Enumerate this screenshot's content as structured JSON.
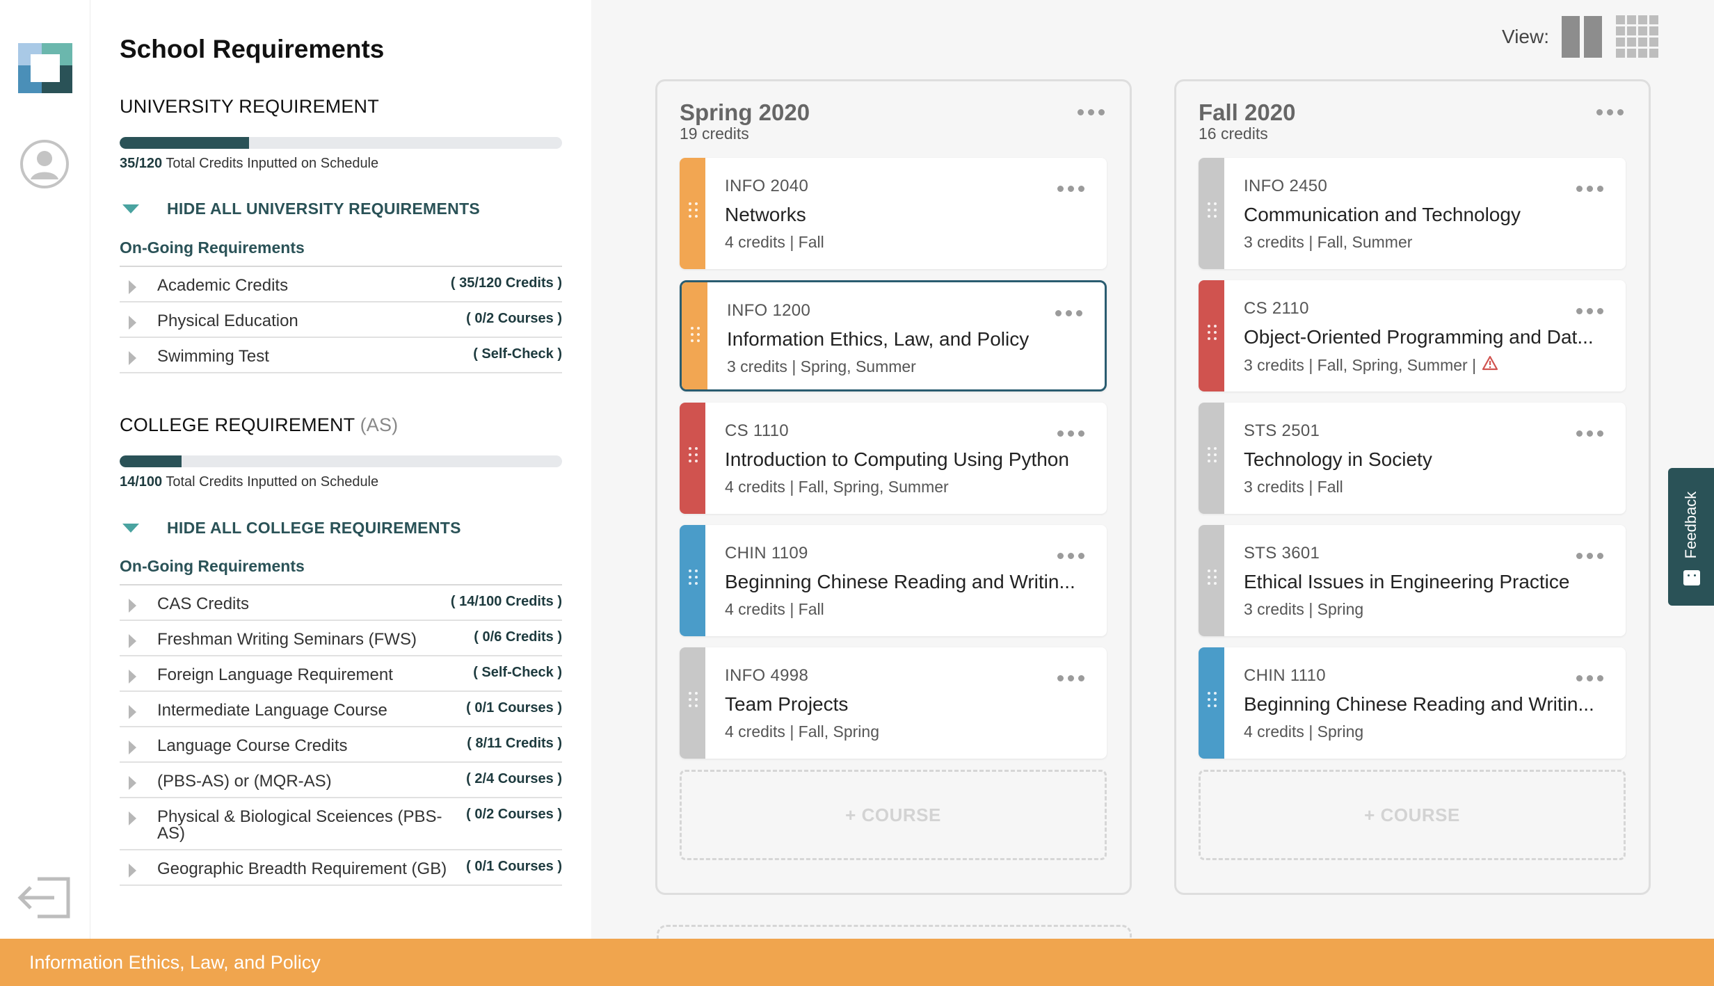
{
  "requirements": {
    "title": "School Requirements",
    "university": {
      "title": "UNIVERSITY REQUIREMENT",
      "progress": 0.2917,
      "progress_value": "35/120",
      "progress_text": "Total Credits Inputted on Schedule",
      "toggle": "HIDE ALL UNIVERSITY REQUIREMENTS",
      "ongoing": "On-Going Requirements",
      "rows": [
        {
          "name": "Academic Credits",
          "value": "( 35/120 Credits )"
        },
        {
          "name": "Physical Education",
          "value": "( 0/2 Courses )"
        },
        {
          "name": "Swimming Test",
          "value": "( Self-Check )"
        }
      ]
    },
    "college": {
      "title": "COLLEGE REQUIREMENT",
      "subtitle": "(AS)",
      "progress": 0.14,
      "progress_value": "14/100",
      "progress_text": "Total Credits Inputted on Schedule",
      "toggle": "HIDE ALL COLLEGE REQUIREMENTS",
      "ongoing": "On-Going Requirements",
      "rows": [
        {
          "name": "CAS Credits",
          "value": "( 14/100 Credits )"
        },
        {
          "name": "Freshman Writing Seminars (FWS)",
          "value": "( 0/6 Credits )"
        },
        {
          "name": "Foreign Language Requirement",
          "value": "( Self-Check )"
        },
        {
          "name": "Intermediate Language Course",
          "value": "( 0/1 Courses )"
        },
        {
          "name": "Language Course Credits",
          "value": "( 8/11 Credits )"
        },
        {
          "name": "(PBS-AS) or (MQR-AS)",
          "value": "( 2/4 Courses )"
        },
        {
          "name": "Physical & Biological Sceiences (PBS-AS)",
          "value": "( 0/2 Courses )"
        },
        {
          "name": "Geographic Breadth Requirement (GB)",
          "value": "( 0/1 Courses )"
        }
      ]
    }
  },
  "view": {
    "label": "View:"
  },
  "semesters": [
    {
      "name": "Spring 2020",
      "credits": "19 credits",
      "add_label": "+ COURSE",
      "courses": [
        {
          "code": "INFO 2040",
          "title": "Networks",
          "meta": "4 credits | Fall",
          "color": "#f2a652",
          "selected": false,
          "warn": false
        },
        {
          "code": "INFO 1200",
          "title": "Information Ethics, Law, and Policy",
          "meta": "3 credits | Spring, Summer",
          "color": "#f2a652",
          "selected": true,
          "warn": false
        },
        {
          "code": "CS 1110",
          "title": "Introduction to Computing Using Python",
          "meta": "4 credits | Fall, Spring, Summer",
          "color": "#d0534f",
          "selected": false,
          "warn": false
        },
        {
          "code": "CHIN 1109",
          "title": "Beginning Chinese Reading and Writin...",
          "meta": "4 credits | Fall",
          "color": "#4a9cc9",
          "selected": false,
          "warn": false
        },
        {
          "code": "INFO 4998",
          "title": "Team Projects",
          "meta": "4 credits | Fall, Spring",
          "color": "#c8c8c8",
          "selected": false,
          "warn": false
        }
      ]
    },
    {
      "name": "Fall 2020",
      "credits": "16 credits",
      "add_label": "+ COURSE",
      "courses": [
        {
          "code": "INFO 2450",
          "title": "Communication and Technology",
          "meta": "3 credits | Fall, Summer",
          "color": "#c8c8c8",
          "selected": false,
          "warn": false
        },
        {
          "code": "CS 2110",
          "title": "Object-Oriented Programming and Dat...",
          "meta": "3 credits | Fall, Spring, Summer |",
          "color": "#d0534f",
          "selected": false,
          "warn": true
        },
        {
          "code": "STS 2501",
          "title": "Technology in Society",
          "meta": "3 credits | Fall",
          "color": "#c8c8c8",
          "selected": false,
          "warn": false
        },
        {
          "code": "STS 3601",
          "title": "Ethical Issues in Engineering Practice",
          "meta": "3 credits | Spring",
          "color": "#c8c8c8",
          "selected": false,
          "warn": false
        },
        {
          "code": "CHIN 1110",
          "title": "Beginning Chinese Reading and Writin...",
          "meta": "4 credits | Spring",
          "color": "#4a9cc9",
          "selected": false,
          "warn": false
        }
      ]
    }
  ],
  "feedback": {
    "label": "Feedback"
  },
  "bottom_bar": {
    "text": "Information Ethics, Law, and Policy"
  },
  "icons": {
    "logo": "app-logo-icon",
    "profile": "user-profile-icon",
    "logout": "logout-icon",
    "warning": "warning-triangle-icon"
  }
}
